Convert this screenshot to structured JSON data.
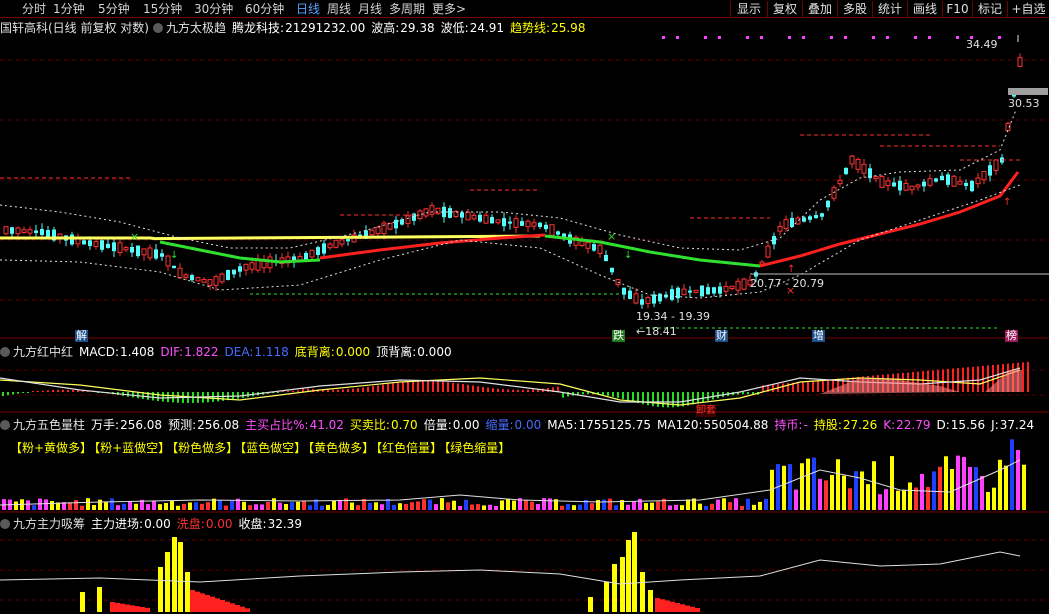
{
  "toolbar": {
    "periods": [
      "分时",
      "1分钟",
      "5分钟",
      "15分钟",
      "30分钟",
      "60分钟",
      "日线",
      "周线",
      "月线",
      "多周期",
      "更多>"
    ],
    "active_period": "日线",
    "right_buttons": [
      "显示",
      "复权",
      "叠加",
      "多股",
      "统计",
      "画线",
      "F10",
      "标记",
      "+自选"
    ]
  },
  "main_panel": {
    "stock_title": "国轩高科(日线 前复权 对数)",
    "indicator_name": "九方太极趋",
    "fields": [
      {
        "label": "腾龙科技:",
        "value": "21291232.00",
        "color": "#ffffff"
      },
      {
        "label": "波高:",
        "value": "29.38",
        "color": "#ffffff"
      },
      {
        "label": "波低:",
        "value": "24.91",
        "color": "#ffffff"
      },
      {
        "label": "趋势线:",
        "value": "25.98",
        "color": "#ffff00"
      }
    ],
    "price_high_label": "34.49",
    "price_current_label": "30.53",
    "range_label_mid": "20.77 - 20.79",
    "range_label_low": "19.34 - 19.39",
    "low_point_label": "18.41",
    "signals": [
      {
        "text": "解",
        "color": "#ffffff",
        "bg": "#1a4f8a"
      },
      {
        "text": "跌",
        "color": "#ffffff",
        "bg": "#1f7a1f"
      },
      {
        "text": "财",
        "color": "#ffffff",
        "bg": "#1a4f8a"
      },
      {
        "text": "增",
        "color": "#ffffff",
        "bg": "#1a4f8a"
      },
      {
        "text": "榜",
        "color": "#ffffff",
        "bg": "#9a1a5a"
      }
    ]
  },
  "macd_panel": {
    "name": "九方红中红",
    "fields": [
      {
        "label": "MACD:",
        "value": "1.408",
        "color": "#ffffff"
      },
      {
        "label": "DIF:",
        "value": "1.822",
        "color": "#ff50ff"
      },
      {
        "label": "DEA:",
        "value": "1.118",
        "color": "#4a6aff"
      },
      {
        "label": "底背离:",
        "value": "0.000",
        "color": "#ffff00"
      },
      {
        "label": "顶背离:",
        "value": "0.000",
        "color": "#ffffff"
      }
    ],
    "marker_label": "卸套"
  },
  "volume_panel": {
    "name": "九方五色量柱",
    "fields": [
      {
        "label": "万手:",
        "value": "256.08",
        "color": "#ffffff"
      },
      {
        "label": "预测:",
        "value": "256.08",
        "color": "#ffffff"
      },
      {
        "label": "主买占比%:",
        "value": "41.02",
        "color": "#ff50ff"
      },
      {
        "label": "买卖比:",
        "value": "0.70",
        "color": "#ffff00"
      },
      {
        "label": "倍量:",
        "value": "0.00",
        "color": "#ffffff"
      },
      {
        "label": "缩量:",
        "value": "0.00",
        "color": "#4a6aff"
      },
      {
        "label": "MA5:",
        "value": "1755125.75",
        "color": "#ffffff"
      },
      {
        "label": "MA120:",
        "value": "550504.88",
        "color": "#ffffff"
      },
      {
        "label": "持币:",
        "value": "-",
        "color": "#ff50ff"
      },
      {
        "label": "持股:",
        "value": "27.26",
        "color": "#ffff00"
      },
      {
        "label": "K:",
        "value": "22.79",
        "color": "#ff50ff"
      },
      {
        "label": "D:",
        "value": "15.56",
        "color": "#ffffff"
      },
      {
        "label": "J:",
        "value": "37.24",
        "color": "#ffffff"
      }
    ],
    "legend": [
      "【粉+黄做多】",
      "【粉+蓝做空】",
      "【粉色做多】",
      "【蓝色做空】",
      "【黄色做多】",
      "【红色倍量】",
      "【绿色缩量】"
    ]
  },
  "inflow_panel": {
    "name": "九方主力吸筹",
    "fields": [
      {
        "label": "主力进场:",
        "value": "0.00",
        "color": "#ffffff"
      },
      {
        "label": "洗盘:",
        "value": "0.00",
        "color": "#ff3030"
      },
      {
        "label": "收盘:",
        "value": "32.39",
        "color": "#ffffff"
      }
    ]
  },
  "colors": {
    "up": "#ff3232",
    "down": "#54fcfc",
    "grid": "#7a0000"
  }
}
